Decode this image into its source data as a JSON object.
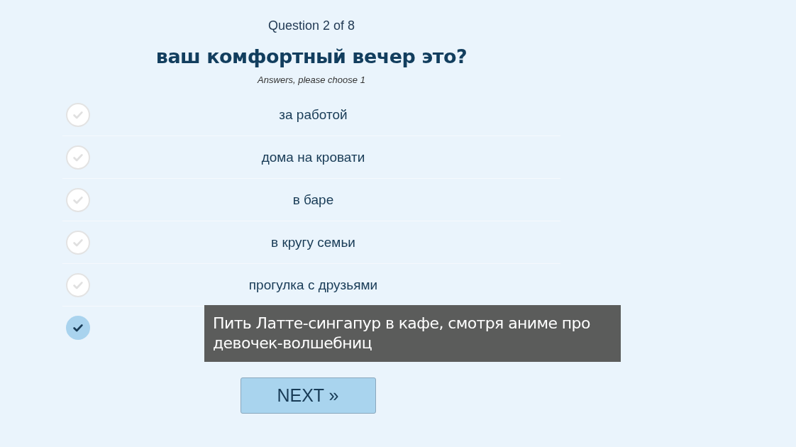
{
  "progress": "Question 2 of 8",
  "question": "ваш комфортный вечер это?",
  "hint": "Answers, please choose 1",
  "options": [
    {
      "label": "за работой",
      "selected": false
    },
    {
      "label": "дома на кровати",
      "selected": false
    },
    {
      "label": "в баре",
      "selected": false
    },
    {
      "label": "в кругу семьи",
      "selected": false
    },
    {
      "label": "прогулка с друзьями",
      "selected": false
    },
    {
      "selected": true
    }
  ],
  "tooltip": "Пить Латте-сингапур в кафе, смотря аниме про девочек-волшебниц",
  "next_button": "NEXT »"
}
